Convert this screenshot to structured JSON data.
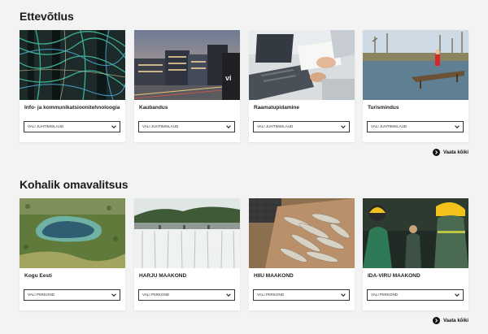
{
  "sections": [
    {
      "title": "Ettevõtlus",
      "see_all": "Vaata kõiki",
      "cards": [
        {
          "label": "Info- ja kommunikatsioonitehnoloogia",
          "select": "VALI JUHTIMISLAUD",
          "image": "server-cables"
        },
        {
          "label": "Kaubandus",
          "select": "VALI JUHTIMISLAUD",
          "image": "city-buildings"
        },
        {
          "label": "Raamatupidamine",
          "select": "VALI JUHTIMISLAUD",
          "image": "laptop-office"
        },
        {
          "label": "Turismindus",
          "select": "VALI JUHTIMISLAUD",
          "image": "lake-pier"
        }
      ]
    },
    {
      "title": "Kohalik omavalitsus",
      "see_all": "Vaata kõiki",
      "cards": [
        {
          "label": "Kogu Eesti",
          "select": "VALI PIIRKOND",
          "image": "forest-lake"
        },
        {
          "label": "HARJU MAAKOND",
          "select": "VALI PIIRKOND",
          "image": "waterfall"
        },
        {
          "label": "HIIU MAAKOND",
          "select": "VALI PIIRKOND",
          "image": "fish-box"
        },
        {
          "label": "IDA-VIRU MAAKOND",
          "select": "VALI PIIRKOND",
          "image": "miners"
        }
      ]
    }
  ],
  "colors": {
    "background": "#f3f3f3",
    "card": "#ffffff",
    "text": "#1a1a1a",
    "border": "#333333"
  }
}
